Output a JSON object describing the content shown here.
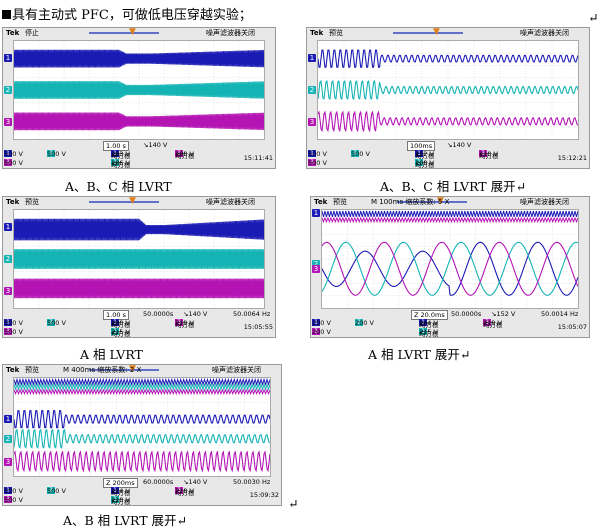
{
  "heading": "具有主动式 PFC，可做低电压穿越实验；",
  "captions": [
    "A、B、C 相 LVRT",
    "A、B、C 相 LVRT 展开↵",
    "A 相 LVRT",
    "A 相 LVRT 展开↵",
    "A、B 相 LVRT 展开↵",
    "↵",
    "↵"
  ],
  "colors": {
    "ch1": "#1a1ab4",
    "ch2": "#14b4b4",
    "ch3": "#b414b4"
  },
  "scopes": [
    {
      "brand": "Tek",
      "mode": "停止",
      "extra": "",
      "state": "噪声滤波器关闭",
      "scale": [
        "1.00 s",
        "↘140 V"
      ],
      "row1": [
        "500 V",
        "500 V",
        "均方根",
        "183 V",
        "均方根",
        "188 V"
      ],
      "row2": [
        "500 V",
        "",
        "均方根",
        "186 V",
        ""
      ],
      "freq": "",
      "time": "15:11:41",
      "ch": [
        "1",
        "2",
        "3"
      ]
    },
    {
      "brand": "Tek",
      "mode": "预览",
      "extra": "",
      "state": "噪声滤波器关闭",
      "scale": [
        "100ms",
        "↘140 V"
      ],
      "row1": [
        "500 V",
        "500 V",
        "均方根",
        "112 V",
        "均方根",
        "110 V"
      ],
      "row2": [
        "500 V",
        "",
        "均方根",
        "108 V",
        ""
      ],
      "freq": "",
      "time": "15:12:21",
      "ch": [
        "1",
        "2",
        "3"
      ]
    },
    {
      "brand": "Tek",
      "mode": "预览",
      "extra": "",
      "state": "噪声滤波器关闭",
      "scale": [
        "1.00 s",
        "50.0000s",
        "↘140 V",
        "50.0064 Hz"
      ],
      "row1": [
        "500 V",
        "500 V",
        "均方根",
        "180 V",
        "均方根",
        "219 V"
      ],
      "row2": [
        "500 V",
        "",
        "均方根",
        "215 V",
        ""
      ],
      "freq": "",
      "time": "15:05:55",
      "ch": [
        "1",
        "2",
        "3"
      ]
    },
    {
      "brand": "Tek",
      "mode": "预览",
      "extra": "M 100ms 缩放系数: 5 X",
      "state": "噪声滤波器关闭",
      "scale": [
        "Z 20.0ms",
        "50.0000s",
        "↘152 V",
        "50.0014 Hz"
      ],
      "row1": [
        "200 V",
        "200 V",
        "均方根",
        "144 V",
        "均方根",
        "219 V"
      ],
      "row2": [
        "200 V",
        "",
        "均方根",
        "215 V",
        ""
      ],
      "freq": "",
      "time": "15:05:07",
      "ch": [
        "1",
        "2",
        "3"
      ]
    },
    {
      "brand": "Tek",
      "mode": "预览",
      "extra": "M 400ms 缩放系数: 2 X",
      "state": "噪声滤波器关闭",
      "scale": [
        "Z 200ms",
        "60.0000s",
        "↘140 V",
        "50.0030 Hz"
      ],
      "row1": [
        "500 V",
        "500 V",
        "均方根",
        "114 V",
        "均方根",
        "218 V"
      ],
      "row2": [
        "500 V",
        "",
        "均方根",
        "110 V",
        ""
      ],
      "freq": "",
      "time": "15:09:32",
      "ch": [
        "1",
        "2",
        "3"
      ]
    }
  ]
}
